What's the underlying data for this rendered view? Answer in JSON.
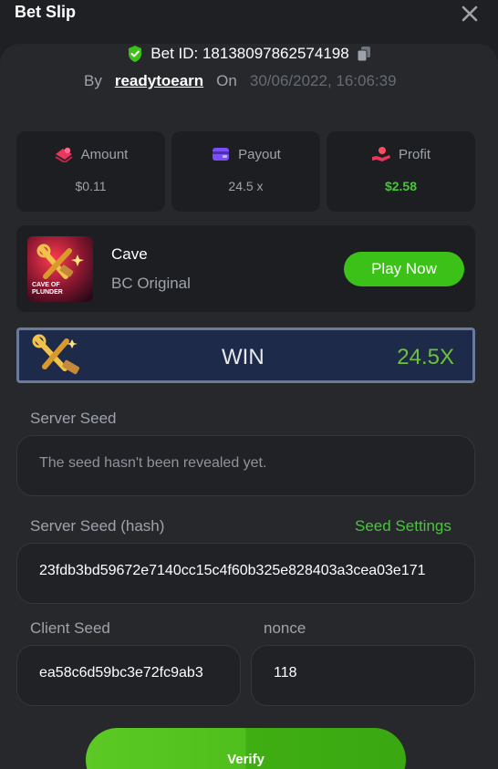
{
  "header": {
    "title": "Bet Slip"
  },
  "bet": {
    "id_text": "Bet ID: 18138097862574198",
    "by_label": "By",
    "username": "readytoearn",
    "on_label": "On",
    "datetime": "30/06/2022, 16:06:39"
  },
  "stats": {
    "amount": {
      "label": "Amount",
      "value": "$0.11",
      "icon": "chips-icon"
    },
    "payout": {
      "label": "Payout",
      "value": "24.5 x",
      "icon": "wallet-icon"
    },
    "profit": {
      "label": "Profit",
      "value": "$2.58",
      "icon": "hand-coin-icon"
    }
  },
  "game": {
    "name": "Cave",
    "provider": "BC Original",
    "thumb_text": "CAVE OF PLUNDER",
    "play_label": "Play Now"
  },
  "result": {
    "outcome": "WIN",
    "multiplier": "24.5X"
  },
  "seeds": {
    "server_seed_label": "Server Seed",
    "server_seed_value": "The seed hasn't been revealed yet.",
    "server_hash_label": "Server Seed (hash)",
    "seed_settings_label": "Seed Settings",
    "server_hash_value": "23fdb3bd59672e7140cc15c4f60b325e828403a3cea03e171",
    "client_seed_label": "Client Seed",
    "client_seed_value": "ea58c6d59bc3e72fc9ab3",
    "nonce_label": "nonce",
    "nonce_value": "118"
  },
  "actions": {
    "verify_label": "Verify"
  },
  "colors": {
    "accent_green": "#3bc117",
    "profit_green": "#48c63a",
    "background": "#1e2023",
    "panel": "#26282c",
    "card": "#1c1e21"
  }
}
